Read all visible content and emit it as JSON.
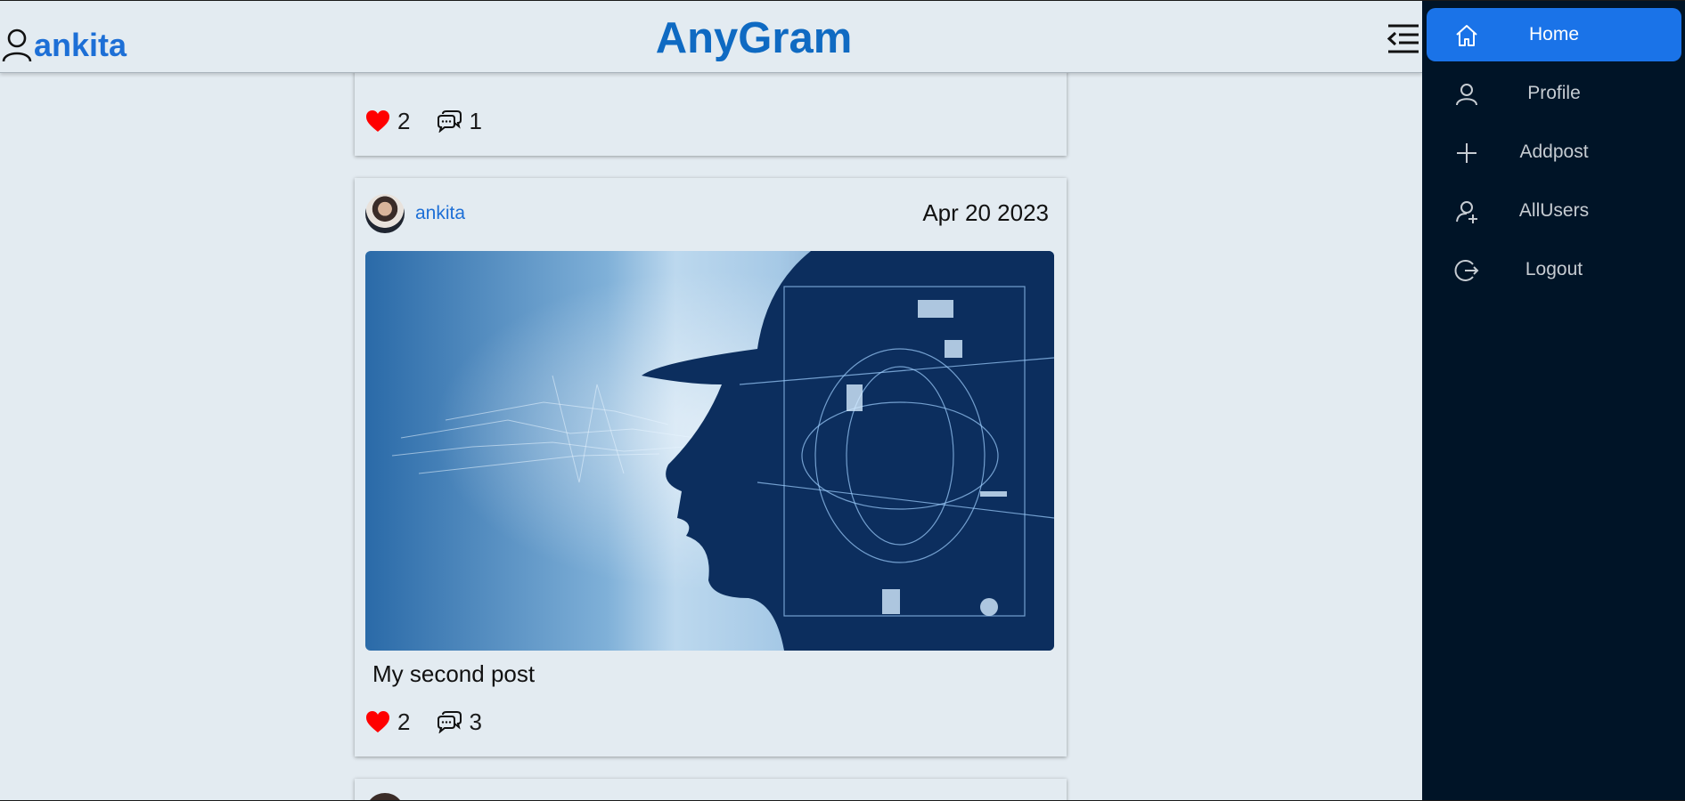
{
  "header": {
    "username": "ankita",
    "brand": "AnyGram"
  },
  "feed": {
    "posts": [
      {
        "likes": "2",
        "comments": "1"
      },
      {
        "author": "ankita",
        "date": "Apr 20 2023",
        "caption": "My second post",
        "likes": "2",
        "comments": "3"
      }
    ]
  },
  "sidebar": {
    "items": [
      {
        "label": "Home",
        "icon": "home-icon",
        "active": true
      },
      {
        "label": "Profile",
        "icon": "user-icon"
      },
      {
        "label": "Addpost",
        "icon": "plus-icon"
      },
      {
        "label": "AllUsers",
        "icon": "users-add-icon"
      },
      {
        "label": "Logout",
        "icon": "logout-icon"
      }
    ]
  },
  "colors": {
    "accent": "#1a73e8",
    "brand": "#0f6ac2",
    "sidebar_bg": "#001427",
    "page_bg": "#e3ebf1",
    "like": "#ff0000"
  }
}
